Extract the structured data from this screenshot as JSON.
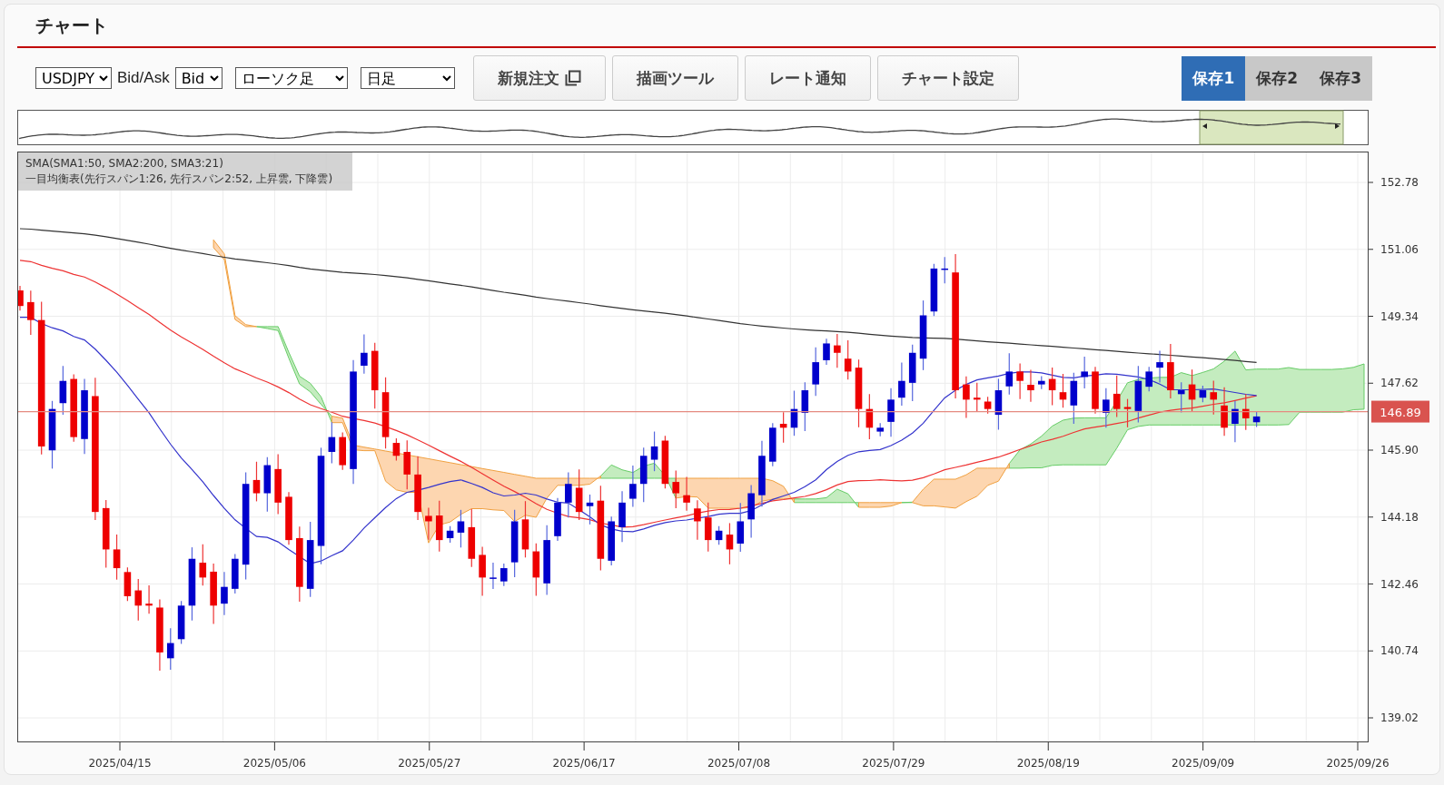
{
  "title": "チャート",
  "toolbar": {
    "symbol": {
      "value": "USDJPY"
    },
    "bid_ask_label": "Bid/Ask",
    "price_side": {
      "value": "Bid"
    },
    "chart_type": {
      "value": "ローソク足"
    },
    "timeframe": {
      "value": "日足"
    },
    "buttons": [
      {
        "label": "新規注文",
        "kind": "external"
      },
      {
        "label": "描画ツール",
        "kind": "plain"
      },
      {
        "label": "レート通知",
        "kind": "plain"
      },
      {
        "label": "チャート設定",
        "kind": "plain"
      }
    ]
  },
  "saves": [
    {
      "label": "保存1",
      "selected": true
    },
    {
      "label": "保存2",
      "selected": false
    },
    {
      "label": "保存3",
      "selected": false
    }
  ],
  "legend": [
    "SMA(SMA1:50, SMA2:200, SMA3:21)",
    "一目均衡表(先行スパン1:26, 先行スパン2:52, 上昇雲, 下降雲)"
  ],
  "price_axis": [
    "152.78",
    "151.06",
    "149.34",
    "147.62",
    "145.90",
    "144.18",
    "142.46",
    "140.74",
    "139.02"
  ],
  "current_price": "146.89",
  "date_axis": [
    "2025/04/15",
    "2025/05/06",
    "2025/05/27",
    "2025/06/17",
    "2025/07/08",
    "2025/07/29",
    "2025/08/19",
    "2025/09/09",
    "2025/09/26"
  ]
}
